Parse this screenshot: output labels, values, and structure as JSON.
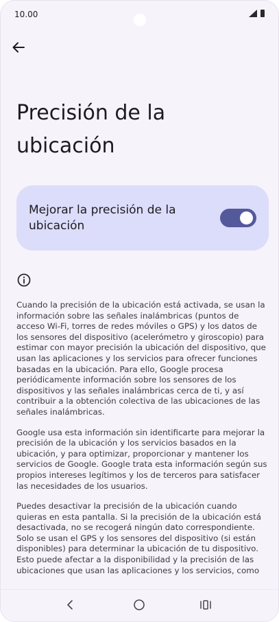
{
  "status_bar": {
    "time": "10.00",
    "icons": [
      "signal-icon",
      "battery-icon"
    ]
  },
  "header": {
    "back_icon": "arrow-back-icon",
    "title": "Precisión de la ubicación"
  },
  "toggle": {
    "label": "Mejorar la precisión de la ubicación",
    "enabled": true,
    "card_color": "#dcdcfb",
    "switch_color": "#54599b"
  },
  "info": {
    "icon": "info-icon",
    "paragraphs": [
      "Cuando la precisión de la ubicación está activada, se usan la información sobre las señales inalámbricas (puntos de acceso Wi-Fi, torres de redes móviles o GPS) y los datos de los sensores del dispositivo (acelerómetro y giroscopio) para estimar con mayor precisión la ubicación del dispositivo, que usan las aplicaciones y los servicios para ofrecer funciones basadas en la ubicación. Para ello, Google procesa periódicamente información sobre los sensores de los dispositivos y las señales inalámbricas cerca de ti, y así contribuir a la obtención colectiva de las ubicaciones de las señales inalámbricas.",
      "Google usa esta información sin identificarte para mejorar la precisión de la ubicación y los servicios basados en la ubicación, y para optimizar, proporcionar y mantener los servicios de Google. Google trata esta información según sus propios intereses legítimos y los de terceros para satisfacer las necesidades de los usuarios.",
      "Puedes desactivar la precisión de la ubicación cuando quieras en esta pantalla. Si la precisión de la ubicación está desactivada, no se recogerá ningún dato correspondiente. Solo se usan el GPS y los sensores del dispositivo (si están disponibles) para determinar la ubicación de tu dispositivo. Esto puede afectar a la disponibilidad y la precisión de las ubicaciones que usan las aplicaciones y los servicios, como"
    ]
  },
  "nav_bar": {
    "back_icon": "nav-back-icon",
    "home_icon": "nav-home-icon",
    "recents_icon": "nav-recents-icon"
  }
}
